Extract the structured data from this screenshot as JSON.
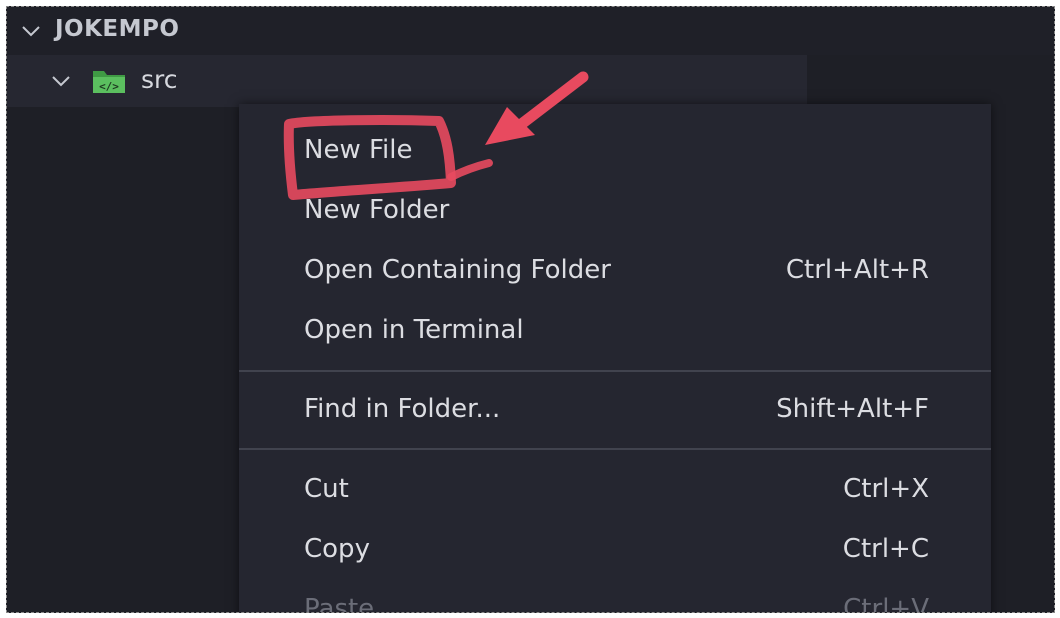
{
  "explorer": {
    "title": "JOKEMPO",
    "folder": {
      "name": "src",
      "icon": "folder-source-icon",
      "icon_color": "#4caf50"
    }
  },
  "context_menu": {
    "groups": [
      [
        {
          "label": "New File",
          "shortcut": ""
        },
        {
          "label": "New Folder",
          "shortcut": ""
        },
        {
          "label": "Open Containing Folder",
          "shortcut": "Ctrl+Alt+R"
        },
        {
          "label": "Open in Terminal",
          "shortcut": ""
        }
      ],
      [
        {
          "label": "Find in Folder...",
          "shortcut": "Shift+Alt+F"
        }
      ],
      [
        {
          "label": "Cut",
          "shortcut": "Ctrl+X"
        },
        {
          "label": "Copy",
          "shortcut": "Ctrl+C"
        },
        {
          "label": "Paste",
          "shortcut": "Ctrl+V",
          "disabled": true
        }
      ]
    ]
  },
  "annotation": {
    "color": "#e84a5f",
    "target": "New File"
  }
}
